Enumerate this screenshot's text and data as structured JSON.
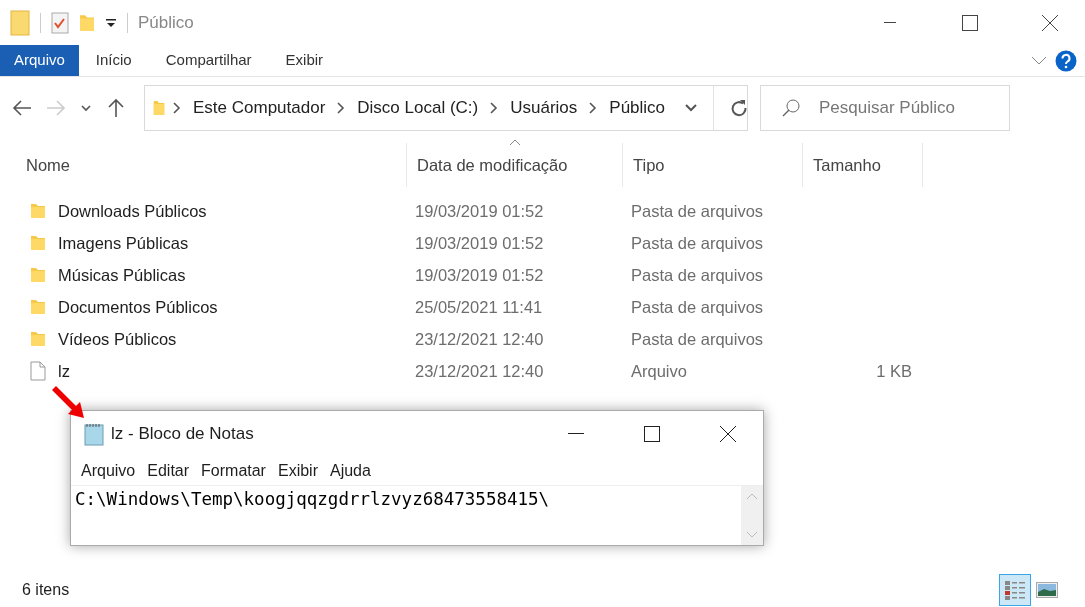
{
  "window": {
    "title": "Público"
  },
  "ribbon_tabs": [
    {
      "label": "Arquivo",
      "selected": true
    },
    {
      "label": "Início",
      "selected": false
    },
    {
      "label": "Compartilhar",
      "selected": false
    },
    {
      "label": "Exibir",
      "selected": false
    }
  ],
  "address": {
    "path": [
      "Este Computador",
      "Disco Local (C:)",
      "Usuários",
      "Público"
    ]
  },
  "search": {
    "placeholder": "Pesquisar Público"
  },
  "columns": [
    {
      "label": "Nome",
      "sorted": false
    },
    {
      "label": "Data de modificação",
      "sorted": true
    },
    {
      "label": "Tipo",
      "sorted": false
    },
    {
      "label": "Tamanho",
      "sorted": false
    }
  ],
  "rows": [
    {
      "kind": "folder",
      "name": "Downloads Públicos",
      "modified": "19/03/2019 01:52",
      "type": "Pasta de arquivos"
    },
    {
      "kind": "folder",
      "name": "Imagens Públicas",
      "modified": "19/03/2019 01:52",
      "type": "Pasta de arquivos"
    },
    {
      "kind": "folder",
      "name": "Músicas Públicas",
      "modified": "19/03/2019 01:52",
      "type": "Pasta de arquivos"
    },
    {
      "kind": "folder",
      "name": "Documentos Públicos",
      "modified": "25/05/2021 11:41",
      "type": "Pasta de arquivos"
    },
    {
      "kind": "folder",
      "name": "Vídeos Públicos",
      "modified": "23/12/2021 12:40",
      "type": "Pasta de arquivos"
    },
    {
      "kind": "file",
      "name": "lz",
      "modified": "23/12/2021 12:40",
      "type": "Arquivo",
      "size": "1 KB"
    }
  ],
  "status_bar": {
    "count": "6 itens"
  },
  "view_buttons": [
    {
      "kind": "details",
      "selected": true
    },
    {
      "kind": "thumbnails",
      "selected": false
    }
  ],
  "notepad": {
    "title": "lz - Bloco de Notas",
    "menu": [
      "Arquivo",
      "Editar",
      "Formatar",
      "Exibir",
      "Ajuda"
    ],
    "text": "C:\\Windows\\Temp\\koogjqqzgdrrlzvyz68473558415\\"
  }
}
